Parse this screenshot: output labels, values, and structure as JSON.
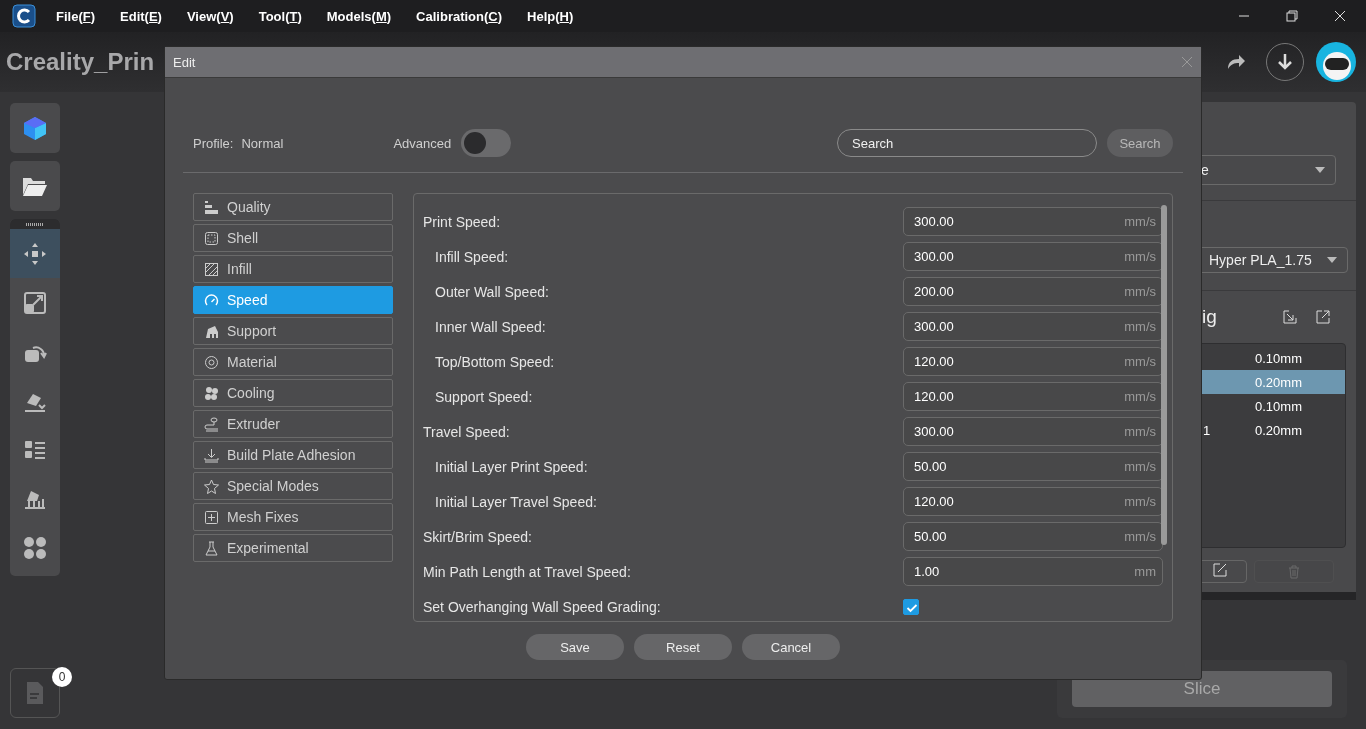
{
  "menu": [
    {
      "before": "File(",
      "key": "F",
      "after": ")"
    },
    {
      "before": "Edit(",
      "key": "E",
      "after": ")"
    },
    {
      "before": "View(",
      "key": "V",
      "after": ")"
    },
    {
      "before": "Tool(",
      "key": "T",
      "after": ")"
    },
    {
      "before": "Models(",
      "key": "M",
      "after": ")"
    },
    {
      "before": "Calibration(",
      "key": "C",
      "after": ")"
    },
    {
      "before": "Help(",
      "key": "H",
      "after": ")"
    }
  ],
  "project_title": "Creality_Prin",
  "tools": [
    {
      "selected": true
    },
    {
      "selected": false
    },
    {
      "selected": false
    },
    {
      "selected": false
    },
    {
      "selected": false
    },
    {
      "selected": false
    },
    {
      "selected": false
    }
  ],
  "log_badge": "0",
  "right_panel": {
    "printer_select": "e",
    "material_select": "Hyper PLA_1.75",
    "section_title": "ig",
    "profiles": [
      {
        "column_2": "0.10mm",
        "selected": false
      },
      {
        "column_2": "0.20mm",
        "selected": true
      },
      {
        "column_2": "0.10mm",
        "selected": false
      },
      {
        "column_1": "1",
        "column_2": "0.20mm",
        "selected": false
      }
    ],
    "delete_disabled": true
  },
  "slice_button": {
    "label": "Slice",
    "disabled": true
  },
  "dialog": {
    "title": "Edit",
    "profile_label": "Profile:",
    "profile_value": "Normal",
    "advanced_label": "Advanced",
    "advanced_on": false,
    "search": {
      "placeholder": "Search"
    },
    "search_button": "Search",
    "categories": [
      {
        "label": "Quality",
        "selected": false
      },
      {
        "label": "Shell",
        "selected": false
      },
      {
        "label": "Infill",
        "selected": false
      },
      {
        "label": "Speed",
        "selected": true
      },
      {
        "label": "Support",
        "selected": false
      },
      {
        "label": "Material",
        "selected": false
      },
      {
        "label": "Cooling",
        "selected": false
      },
      {
        "label": "Extruder",
        "selected": false
      },
      {
        "label": "Build Plate Adhesion",
        "selected": false
      },
      {
        "label": "Special Modes",
        "selected": false
      },
      {
        "label": "Mesh Fixes",
        "selected": false
      },
      {
        "label": "Experimental",
        "selected": false
      }
    ],
    "settings": [
      {
        "label": "Print Speed:",
        "kind": "field",
        "value": "300.00",
        "unit": "mm/s",
        "children": [
          {
            "label": "Infill Speed:",
            "kind": "field",
            "value": "300.00",
            "unit": "mm/s"
          },
          {
            "label": "Outer Wall Speed:",
            "kind": "field",
            "value": "200.00",
            "unit": "mm/s"
          },
          {
            "label": "Inner Wall Speed:",
            "kind": "field",
            "value": "300.00",
            "unit": "mm/s"
          },
          {
            "label": "Top/Bottom Speed:",
            "kind": "field",
            "value": "120.00",
            "unit": "mm/s"
          },
          {
            "label": "Support Speed:",
            "kind": "field",
            "value": "120.00",
            "unit": "mm/s"
          }
        ]
      },
      {
        "label": "Travel Speed:",
        "kind": "field",
        "value": "300.00",
        "unit": "mm/s",
        "children": [
          {
            "label": "Initial Layer Print Speed:",
            "kind": "field",
            "value": "50.00",
            "unit": "mm/s"
          },
          {
            "label": "Initial Layer Travel Speed:",
            "kind": "field",
            "value": "120.00",
            "unit": "mm/s"
          }
        ]
      },
      {
        "label": "Skirt/Brim Speed:",
        "kind": "field",
        "value": "50.00",
        "unit": "mm/s"
      },
      {
        "label": "Min Path Length at Travel Speed:",
        "kind": "field",
        "value": "1.00",
        "unit": "mm"
      },
      {
        "label": "Set Overhanging Wall Speed Grading:",
        "kind": "checkbox",
        "checked": true
      }
    ],
    "buttons": [
      "Save",
      "Reset",
      "Cancel"
    ]
  }
}
